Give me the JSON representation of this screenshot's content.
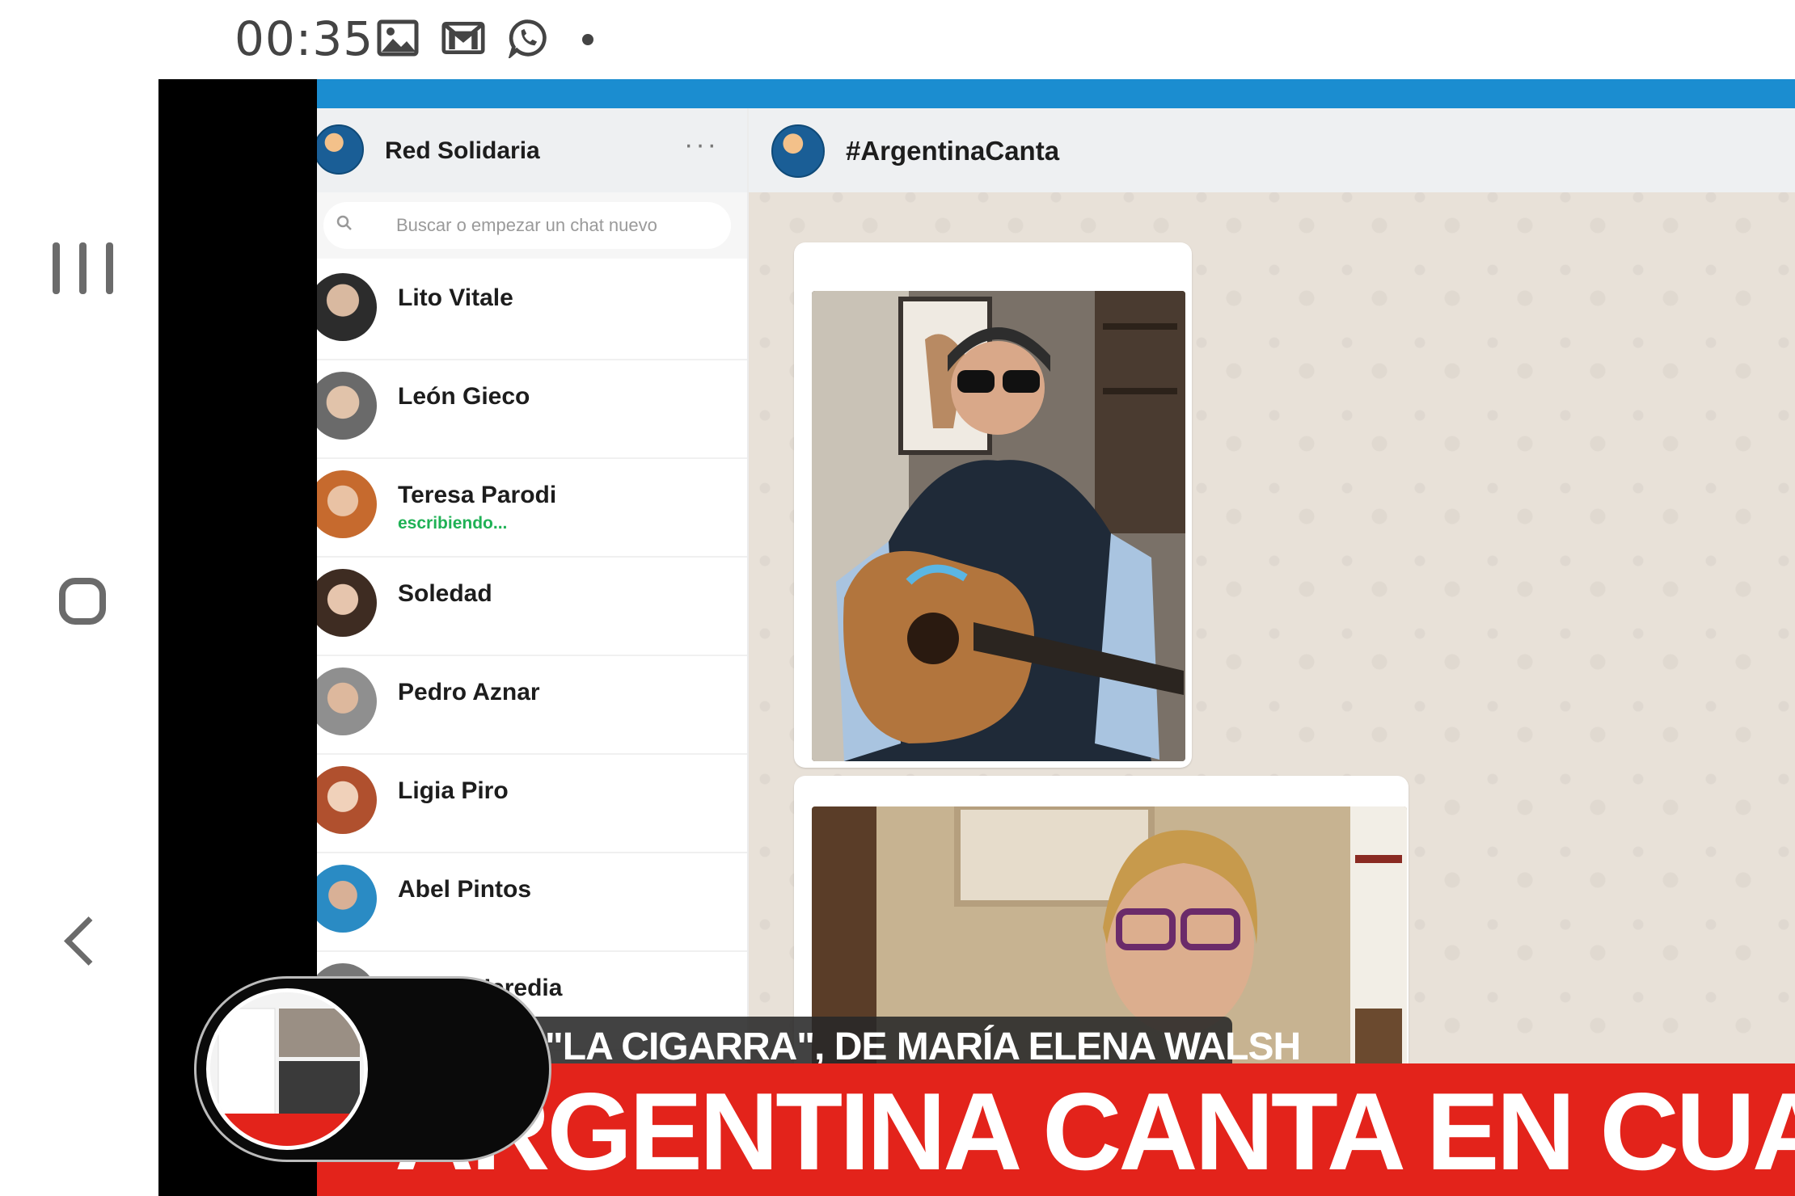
{
  "status_bar": {
    "time": "00:35",
    "icons": [
      "gallery-icon",
      "gmail-icon",
      "whatsapp-icon",
      "notification-dot"
    ]
  },
  "nav_bar": {
    "buttons": [
      "recents-button",
      "home-button",
      "back-button"
    ]
  },
  "video": {
    "sidebar": {
      "group_name": "Red Solidaria",
      "menu_label": "···",
      "search_placeholder": "Buscar o empezar un chat nuevo",
      "chats": [
        {
          "name": "Lito Vitale",
          "status": ""
        },
        {
          "name": "León Gieco",
          "status": ""
        },
        {
          "name": "Teresa Parodi",
          "status": "escribiendo..."
        },
        {
          "name": "Soledad",
          "status": ""
        },
        {
          "name": "Pedro Aznar",
          "status": ""
        },
        {
          "name": "Ligia Piro",
          "status": ""
        },
        {
          "name": "Abel Pintos",
          "status": ""
        },
        {
          "name": "Víctor Heredia",
          "status": ""
        }
      ]
    },
    "chat": {
      "title": "#ArgentinaCanta"
    },
    "lower_third": {
      "subtitle": "\"LA CIGARRA\", DE MARÍA ELENA WALSH",
      "headline": "ARGENTINA CANTA EN CUARENT"
    },
    "colors": {
      "top_stripe": "#1b8dd0",
      "headline_bg": "#e3231b",
      "typing_green": "#1fb155"
    }
  }
}
